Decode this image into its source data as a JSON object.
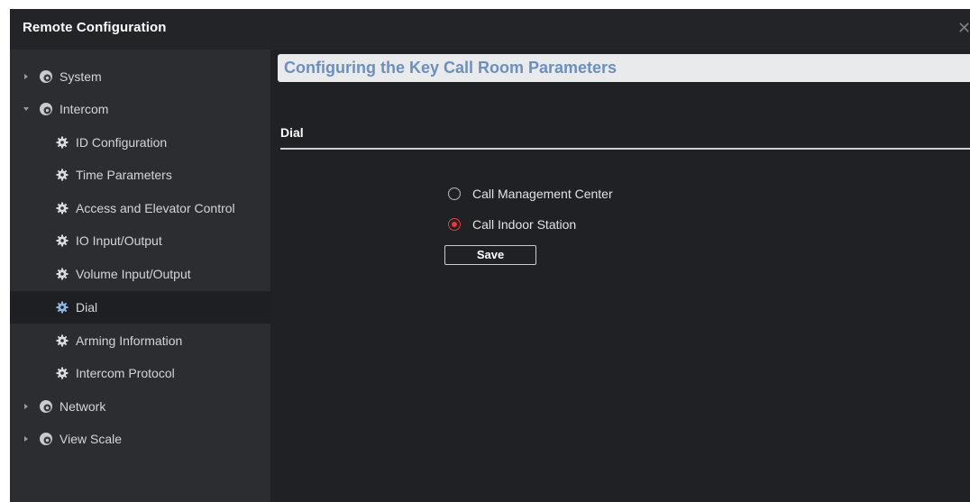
{
  "window": {
    "title": "Remote Configuration",
    "close_glyph": "✕"
  },
  "sidebar": {
    "items": [
      {
        "label": "System",
        "icon": "gear-icon",
        "level": 1,
        "state": "collapsed"
      },
      {
        "label": "Intercom",
        "icon": "gear-icon",
        "level": 1,
        "state": "expanded"
      },
      {
        "label": "ID Configuration",
        "icon": "gear-icon",
        "level": 2
      },
      {
        "label": "Time Parameters",
        "icon": "gear-icon",
        "level": 2
      },
      {
        "label": "Access and Elevator Control",
        "icon": "gear-icon",
        "level": 2
      },
      {
        "label": "IO Input/Output",
        "icon": "gear-icon",
        "level": 2
      },
      {
        "label": "Volume Input/Output",
        "icon": "gear-icon",
        "level": 2
      },
      {
        "label": "Dial",
        "icon": "gear-icon",
        "level": 2,
        "selected": true
      },
      {
        "label": "Arming Information",
        "icon": "gear-icon",
        "level": 2
      },
      {
        "label": "Intercom Protocol",
        "icon": "gear-icon",
        "level": 2
      },
      {
        "label": "Network",
        "icon": "gear-icon",
        "level": 1,
        "state": "collapsed"
      },
      {
        "label": "View Scale",
        "icon": "gear-icon",
        "level": 1,
        "state": "collapsed"
      }
    ]
  },
  "main": {
    "header_title": "Configuring the Key Call Room Parameters",
    "section_title": "Dial",
    "options": [
      {
        "label": "Call Management Center",
        "checked": false
      },
      {
        "label": "Call Indoor Station",
        "checked": true
      }
    ],
    "save_label": "Save"
  },
  "colors": {
    "accent_red": "#e53935",
    "header_title_blue": "#6c8fbd",
    "selected_gear_blue": "#8fb4e3",
    "window_bg": "#1f2124",
    "sidebar_bg": "#2b2d31"
  }
}
